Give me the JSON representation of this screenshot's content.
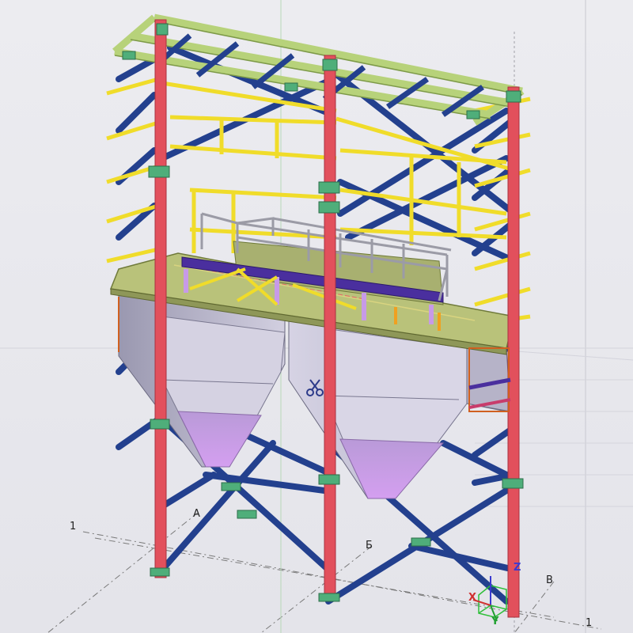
{
  "viewport": {
    "background": "#e8e8ec"
  },
  "colors": {
    "column": "#e2505c",
    "column_dark": "#b8323f",
    "brace": "#23408e",
    "girt": "#f0dc2a",
    "girt_dark": "#c8b41a",
    "roof_beam": "#b7d27a",
    "plate": "#c6cc8c",
    "hopper": "#c8c3d8",
    "hopper_cone": "#c79ae8",
    "beam_purple": "#4a2f9e",
    "handrail": "#9b9ba6",
    "connection": "#4fae7a",
    "grid_line": "#6e6e6e"
  },
  "grid_labels": {
    "row_1": "1",
    "row_A": "А",
    "row_B": "Б",
    "row_V": "В",
    "row_1b": "1"
  },
  "axis_gizmo": {
    "x": "X",
    "y": "Y",
    "z": "Z"
  },
  "icons": {
    "scissors": "scissors-icon",
    "gizmo": "axis-gizmo-icon"
  }
}
